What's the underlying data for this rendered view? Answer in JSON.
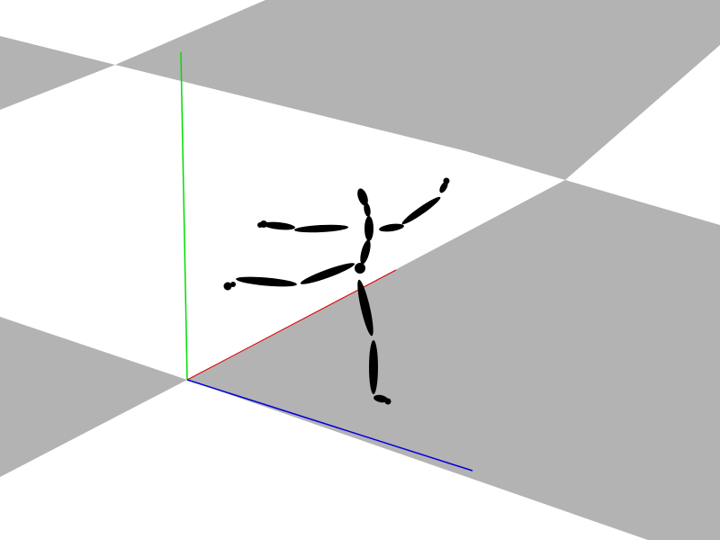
{
  "scene": {
    "background_color": "#ffffff",
    "floor": {
      "light_color": "#ffffff",
      "dark_color": "#b3b3b3"
    },
    "axes": {
      "x_color": "#dd0000",
      "y_color": "#00dd00",
      "z_color": "#0000dd"
    },
    "figure": {
      "color": "#000000"
    }
  }
}
